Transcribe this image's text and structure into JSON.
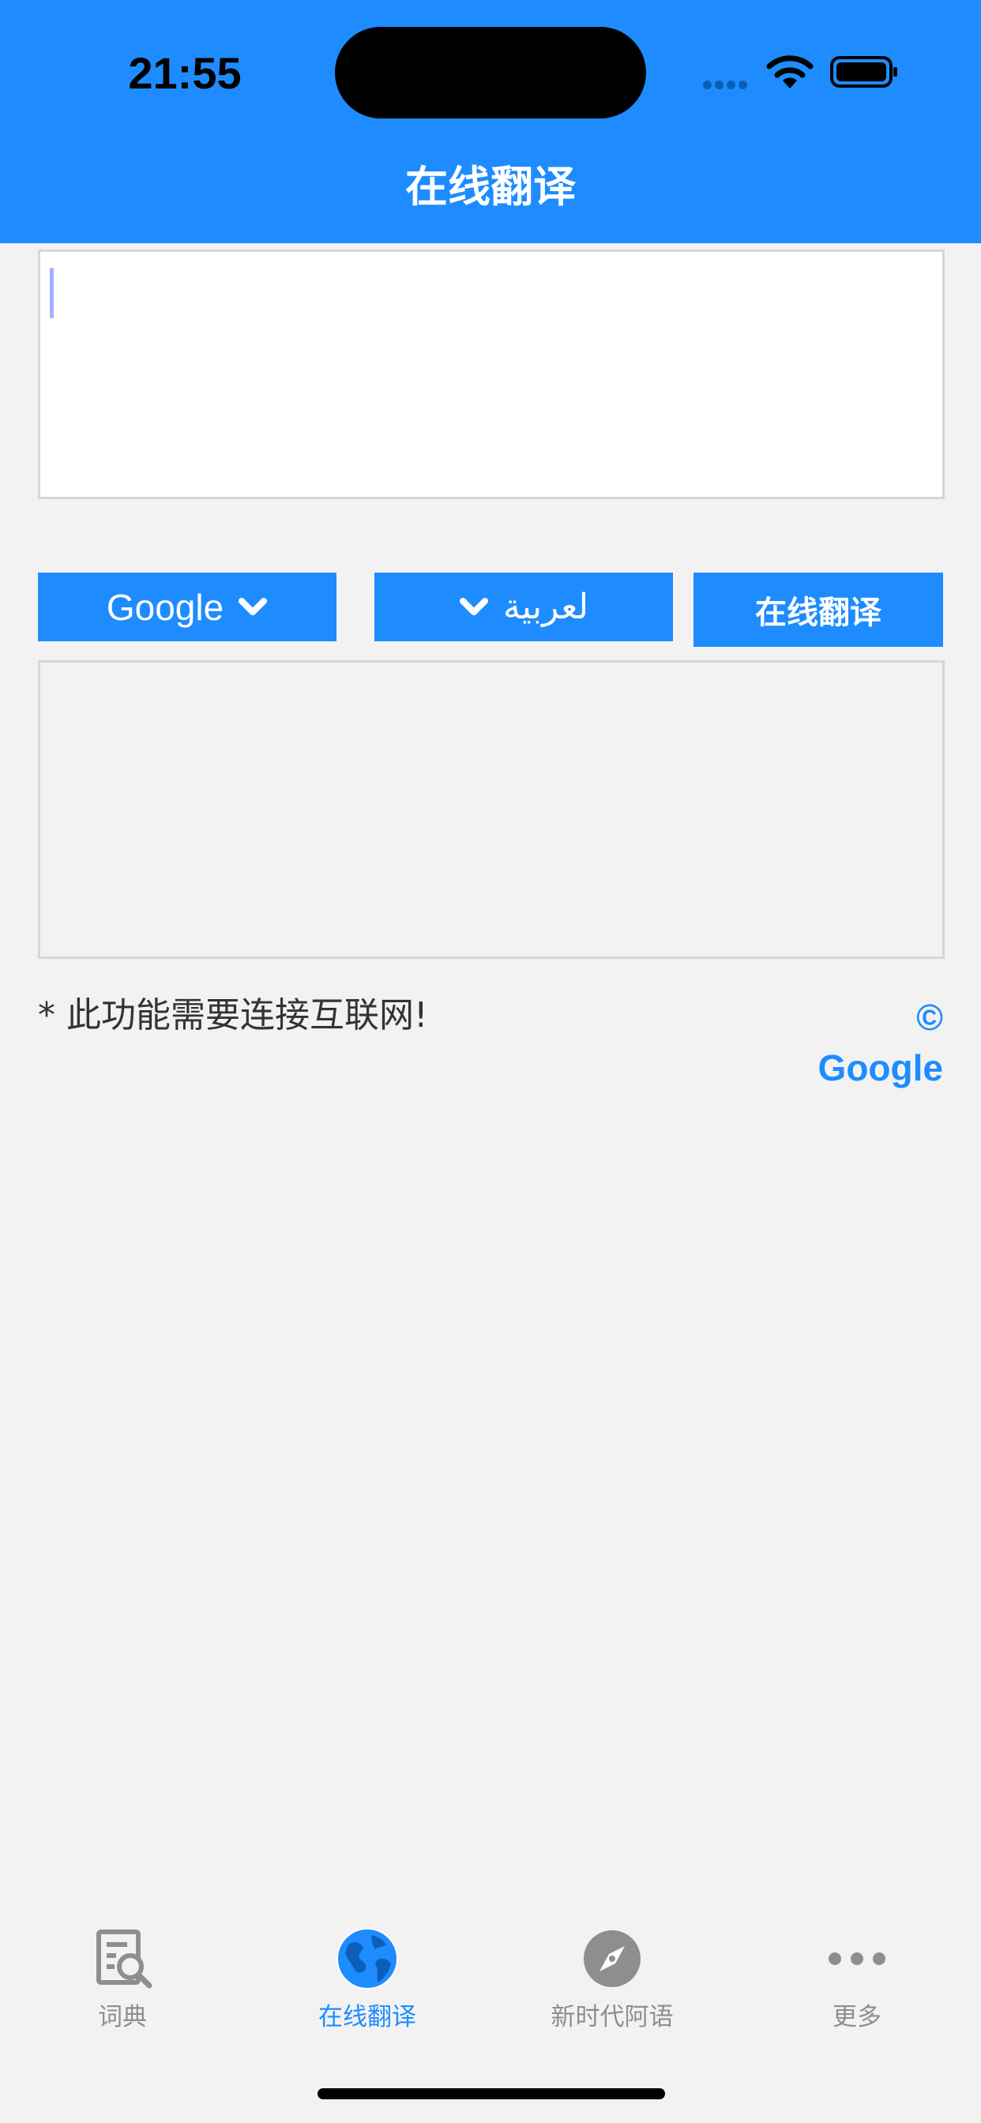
{
  "status_bar": {
    "time": "21:55"
  },
  "header": {
    "title": "在线翻译"
  },
  "translator": {
    "input_value": "",
    "engine_label": "Google",
    "language_label": "لعربية",
    "translate_label": "在线翻译",
    "output_value": "",
    "note": "* 此功能需要连接互联网!",
    "credit": "© Google"
  },
  "tabs": [
    {
      "label": "词典",
      "icon": "dictionary-search-icon"
    },
    {
      "label": "在线翻译",
      "icon": "globe-icon",
      "active": true
    },
    {
      "label": "新时代阿语",
      "icon": "compass-icon"
    },
    {
      "label": "更多",
      "icon": "more-dots-icon"
    }
  ],
  "colors": {
    "accent": "#1e8cff",
    "background": "#f2f2f2",
    "inactive": "#8e8e8e"
  }
}
